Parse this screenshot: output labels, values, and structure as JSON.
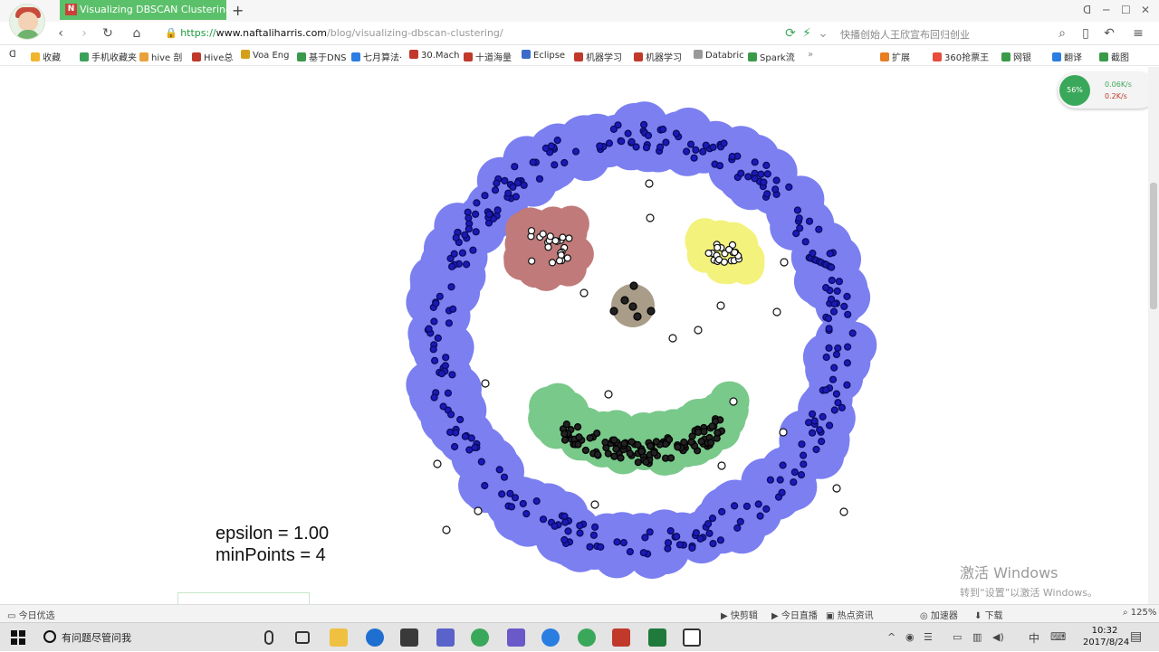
{
  "browser": {
    "tab_title": "Visualizing DBSCAN Clustering",
    "tab_favicon": "N",
    "new_tab": "+",
    "url_scheme": "https://",
    "url_host": "www.naftaliharris.com",
    "url_path": "/blog/visualizing-dbscan-clustering/",
    "search_text": "快播创始人王欣宣布回归创业",
    "window_controls": [
      "ᗡ",
      "─",
      "☐",
      "✕"
    ]
  },
  "bookmarks": [
    {
      "label": "收藏",
      "color": "#f1b52d"
    },
    {
      "label": "手机收藏夹",
      "color": "#3aa05a"
    },
    {
      "label": "hive 剖",
      "color": "#e9a13b"
    },
    {
      "label": "Hive总",
      "color": "#c0392b"
    },
    {
      "label": "Voa Eng",
      "color": "#d4a017"
    },
    {
      "label": "基于DNS",
      "color": "#3a9a4a"
    },
    {
      "label": "七月算法·",
      "color": "#2a7de1"
    },
    {
      "label": "30.Mach",
      "color": "#c0392b"
    },
    {
      "label": "十道海量",
      "color": "#c0392b"
    },
    {
      "label": "Eclipse",
      "color": "#3a6bc9"
    },
    {
      "label": "机器学习",
      "color": "#c0392b"
    },
    {
      "label": "机器学习",
      "color": "#c0392b"
    },
    {
      "label": "Databric",
      "color": "#999999"
    },
    {
      "label": "Spark流",
      "color": "#3a9a4a"
    },
    {
      "label": "扩展",
      "color": "#e67e22"
    },
    {
      "label": "360抢票王",
      "color": "#e74c3c"
    },
    {
      "label": "网银",
      "color": "#3a9a4a"
    },
    {
      "label": "翻译",
      "color": "#2a7de1"
    },
    {
      "label": "截图",
      "color": "#3a9a4a"
    }
  ],
  "page": {
    "epsilon_line": "epsilon = 1.00",
    "minpoints_line": "minPoints = 4",
    "clusters": [
      {
        "name": "outer-ring",
        "color": "#7b7ff0"
      },
      {
        "name": "left-eye",
        "color": "#c07a7a"
      },
      {
        "name": "right-eye",
        "color": "#f3f27c"
      },
      {
        "name": "nose",
        "color": "#a99c88"
      },
      {
        "name": "mouth",
        "color": "#79c98a"
      }
    ]
  },
  "net_widget": {
    "label": "56%",
    "up": "0.06K/s",
    "down": "0.2K/s"
  },
  "watermark": {
    "line1": "激活 Windows",
    "line2": "转到“设置”以激活 Windows。"
  },
  "statusbar": {
    "left": "今日优选",
    "items": [
      "快剪辑",
      "今日直播",
      "热点资讯",
      "加速器",
      "下载",
      "125%"
    ]
  },
  "taskbar": {
    "search_placeholder": "有问题尽管问我",
    "time": "10:32",
    "date": "2017/8/24",
    "ime": "中"
  }
}
